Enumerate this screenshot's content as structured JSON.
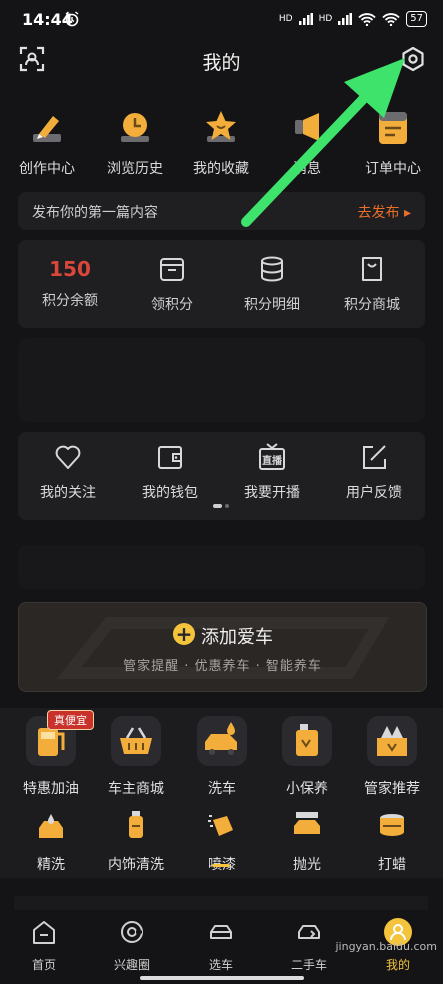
{
  "status_bar": {
    "time": "14:44",
    "network1": "HD",
    "network2": "HD",
    "battery": "57"
  },
  "header": {
    "title": "我的"
  },
  "quick_actions": [
    {
      "label": "创作中心",
      "icon": "pen-icon"
    },
    {
      "label": "浏览历史",
      "icon": "clock-icon"
    },
    {
      "label": "我的收藏",
      "icon": "star-icon"
    },
    {
      "label": "消息",
      "icon": "megaphone-icon"
    },
    {
      "label": "订单中心",
      "icon": "order-list-icon"
    }
  ],
  "publish": {
    "text": "发布你的第一篇内容",
    "action": "去发布 ▸"
  },
  "points": [
    {
      "value": "150",
      "label": "积分余额"
    },
    {
      "label": "领积分",
      "icon": "gift-box-icon"
    },
    {
      "label": "积分明细",
      "icon": "coins-stack-icon"
    },
    {
      "label": "积分商城",
      "icon": "shopping-bag-icon"
    }
  ],
  "tools": [
    {
      "label": "我的关注",
      "icon": "heart-icon"
    },
    {
      "label": "我的钱包",
      "icon": "wallet-icon"
    },
    {
      "label": "我要开播",
      "icon": "live-tv-icon"
    },
    {
      "label": "用户反馈",
      "icon": "edit-feedback-icon"
    }
  ],
  "add_car": {
    "title": "添加爱车",
    "subtitle": "管家提醒  ·  优惠养车  ·  智能养车"
  },
  "services_row1": [
    {
      "label": "特惠加油",
      "icon": "fuel-pump-icon"
    },
    {
      "label": "车主商城",
      "icon": "shopping-basket-icon"
    },
    {
      "label": "洗车",
      "icon": "car-wash-icon"
    },
    {
      "label": "小保养",
      "icon": "oil-can-icon"
    },
    {
      "label": "管家推荐",
      "icon": "recommend-box-icon"
    }
  ],
  "services_row2": [
    {
      "label": "精洗",
      "icon": "fine-wash-icon"
    },
    {
      "label": "内饰清洗",
      "icon": "interior-clean-icon"
    },
    {
      "label": "喷漆",
      "icon": "spray-paint-icon"
    },
    {
      "label": "抛光",
      "icon": "polish-icon"
    },
    {
      "label": "打蜡",
      "icon": "wax-icon"
    }
  ],
  "promo_tag": "真便宜",
  "tabbar": [
    {
      "label": "首页",
      "icon": "home-icon"
    },
    {
      "label": "兴趣圈",
      "icon": "interest-circle-icon"
    },
    {
      "label": "选车",
      "icon": "car-select-icon"
    },
    {
      "label": "二手车",
      "icon": "used-car-icon"
    },
    {
      "label": "我的",
      "icon": "profile-icon"
    }
  ],
  "watermark": "jingyan.baidu.com",
  "colors": {
    "accent": "#f3c43c",
    "points_red": "#d9473a",
    "publish_orange": "#e96f2a",
    "arrow_green": "#3de36a"
  }
}
